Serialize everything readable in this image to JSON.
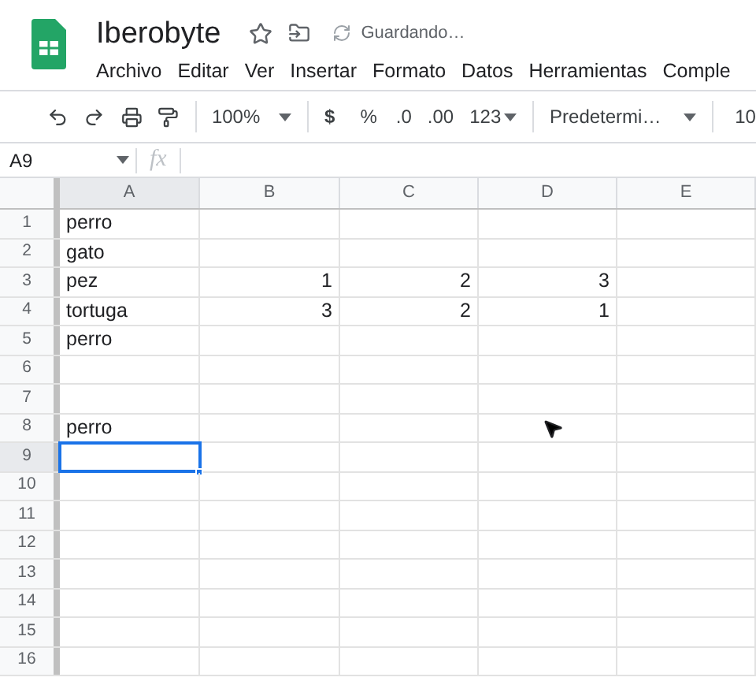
{
  "document": {
    "title": "Iberobyte",
    "status": "Guardando…"
  },
  "menu": [
    "Archivo",
    "Editar",
    "Ver",
    "Insertar",
    "Formato",
    "Datos",
    "Herramientas",
    "Comple"
  ],
  "toolbar": {
    "zoom": "100%",
    "currency": "$",
    "percent": "%",
    "decrease_decimals": ".0",
    "increase_decimals": ".00",
    "number_format": "123",
    "font": "Predetermi…",
    "font_size": "10"
  },
  "name_box": "A9",
  "formula_label": "fx",
  "columns": [
    {
      "label": "A",
      "selected": true
    },
    {
      "label": "B",
      "selected": false
    },
    {
      "label": "C",
      "selected": false
    },
    {
      "label": "D",
      "selected": false
    },
    {
      "label": "E",
      "selected": false
    }
  ],
  "rows": [
    {
      "label": "1",
      "selected": false,
      "cells": [
        "perro",
        null,
        null,
        null,
        null
      ]
    },
    {
      "label": "2",
      "selected": false,
      "cells": [
        "gato",
        null,
        null,
        null,
        null
      ]
    },
    {
      "label": "3",
      "selected": false,
      "cells": [
        "pez",
        "1",
        "2",
        "3",
        null
      ]
    },
    {
      "label": "4",
      "selected": false,
      "cells": [
        "tortuga",
        "3",
        "2",
        "1",
        null
      ]
    },
    {
      "label": "5",
      "selected": false,
      "cells": [
        "perro",
        null,
        null,
        null,
        null
      ]
    },
    {
      "label": "6",
      "selected": false,
      "cells": [
        null,
        null,
        null,
        null,
        null
      ]
    },
    {
      "label": "7",
      "selected": false,
      "cells": [
        null,
        null,
        null,
        null,
        null
      ]
    },
    {
      "label": "8",
      "selected": false,
      "cells": [
        "perro",
        null,
        null,
        null,
        null
      ]
    },
    {
      "label": "9",
      "selected": true,
      "cells": [
        null,
        null,
        null,
        null,
        null
      ]
    },
    {
      "label": "10",
      "selected": false,
      "cells": [
        null,
        null,
        null,
        null,
        null
      ]
    },
    {
      "label": "11",
      "selected": false,
      "cells": [
        null,
        null,
        null,
        null,
        null
      ]
    },
    {
      "label": "12",
      "selected": false,
      "cells": [
        null,
        null,
        null,
        null,
        null
      ]
    },
    {
      "label": "13",
      "selected": false,
      "cells": [
        null,
        null,
        null,
        null,
        null
      ]
    },
    {
      "label": "14",
      "selected": false,
      "cells": [
        null,
        null,
        null,
        null,
        null
      ]
    },
    {
      "label": "15",
      "selected": false,
      "cells": [
        null,
        null,
        null,
        null,
        null
      ]
    },
    {
      "label": "16",
      "selected": false,
      "cells": [
        null,
        null,
        null,
        null,
        null
      ]
    }
  ]
}
